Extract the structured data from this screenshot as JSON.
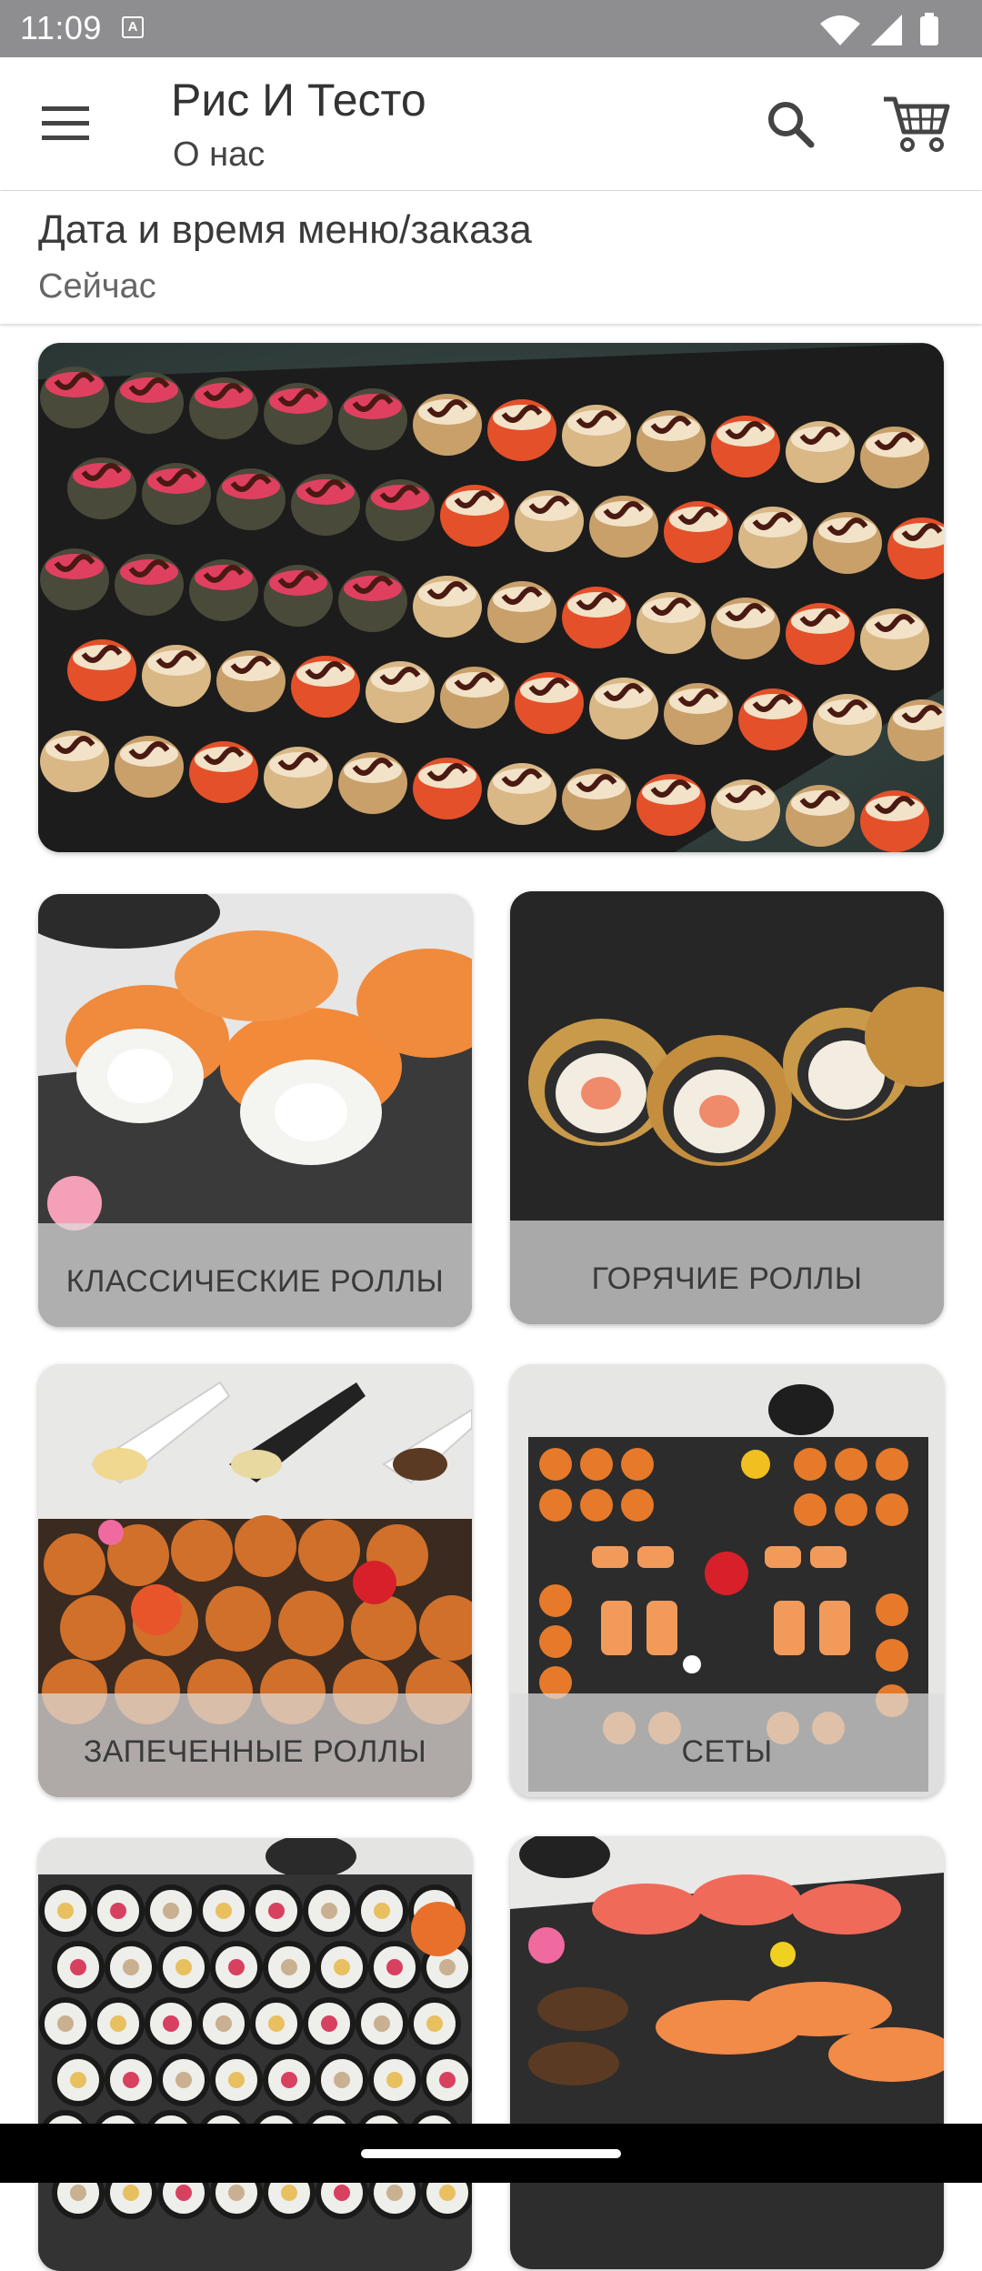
{
  "status_bar": {
    "time": "11:09",
    "notification_icon": "A"
  },
  "app_bar": {
    "title": "Рис И Тесто",
    "subtitle": "О нас",
    "icons": [
      "menu-icon",
      "search-icon",
      "cart-icon"
    ]
  },
  "order_time": {
    "title": "Дата и время меню/заказа",
    "value": "Сейчас"
  },
  "categories": [
    {
      "label": "КЛАССИЧЕСКИЕ РОЛЛЫ"
    },
    {
      "label": "ГОРЯЧИЕ РОЛЛЫ"
    },
    {
      "label": "ЗАПЕЧЕННЫЕ РОЛЛЫ"
    },
    {
      "label": "СЕТЫ"
    },
    {
      "label": ""
    },
    {
      "label": ""
    }
  ],
  "colors": {
    "status_bar": "#8e8e90",
    "label_overlay": "#dcdcdc",
    "text_primary": "#333333"
  }
}
